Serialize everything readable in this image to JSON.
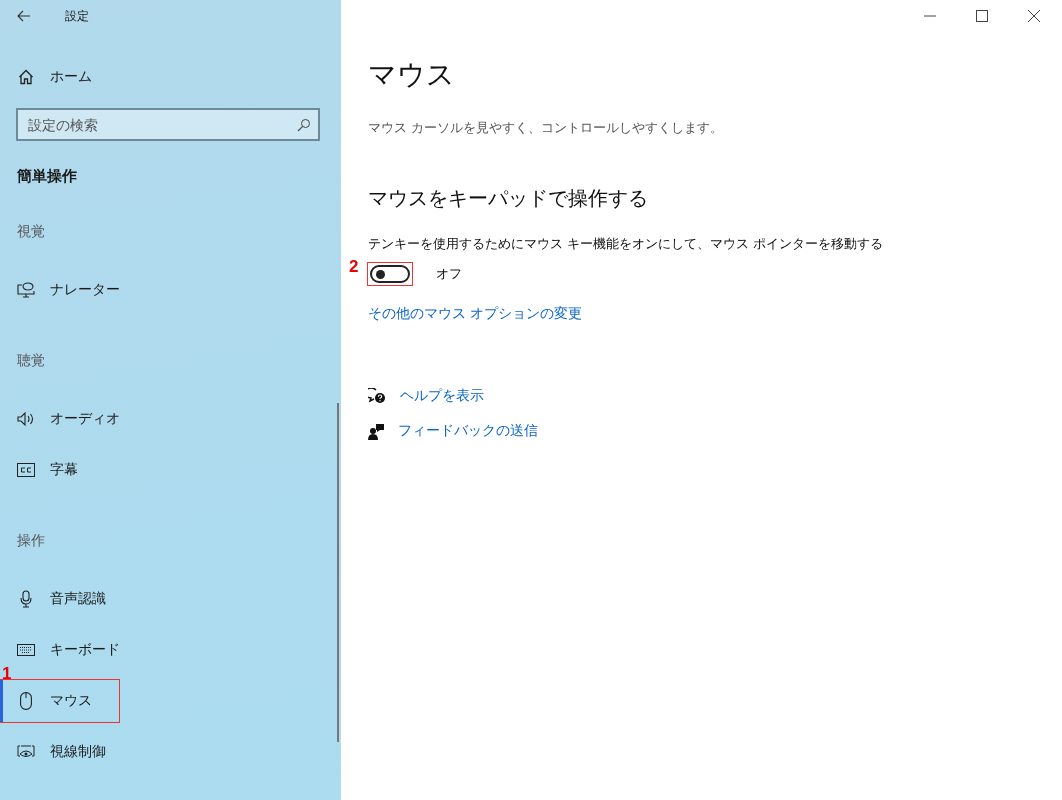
{
  "window": {
    "title": "設定"
  },
  "sidebar": {
    "home": {
      "label": "ホーム"
    },
    "search": {
      "placeholder": "設定の検索"
    },
    "section_title": "簡単操作",
    "groups": [
      {
        "heading": "視覚",
        "items": [
          {
            "kind": "narrator",
            "label": "ナレーター",
            "selected": false
          }
        ]
      },
      {
        "heading": "聴覚",
        "items": [
          {
            "kind": "audio",
            "label": "オーディオ",
            "selected": false
          },
          {
            "kind": "captions",
            "label": "字幕",
            "selected": false
          }
        ]
      },
      {
        "heading": "操作",
        "items": [
          {
            "kind": "speech",
            "label": "音声認識",
            "selected": false
          },
          {
            "kind": "keyboard",
            "label": "キーボード",
            "selected": false
          },
          {
            "kind": "mouse",
            "label": "マウス",
            "selected": true,
            "callout": "1"
          },
          {
            "kind": "eye",
            "label": "視線制御",
            "selected": false
          }
        ]
      }
    ]
  },
  "main": {
    "title": "マウス",
    "subtitle": "マウス カーソルを見やすく、コントロールしやすくします。",
    "section_heading": "マウスをキーパッドで操作する",
    "setting_description": "テンキーを使用するためにマウス キー機能をオンにして、マウス ポインターを移動する",
    "toggle": {
      "on": false,
      "state_label": "オフ",
      "callout": "2"
    },
    "link": "その他のマウス オプションの変更",
    "help_links": [
      {
        "kind": "help",
        "label": "ヘルプを表示"
      },
      {
        "kind": "feedback",
        "label": "フィードバックの送信"
      }
    ]
  }
}
